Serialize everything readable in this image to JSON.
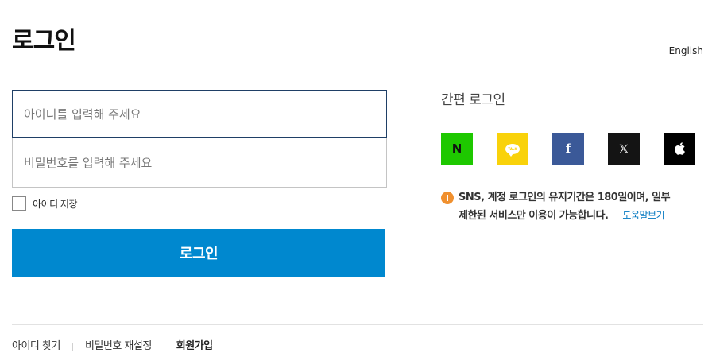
{
  "header": {
    "title": "로그인",
    "language_link": "English"
  },
  "form": {
    "id_placeholder": "아이디를 입력해 주세요",
    "password_placeholder": "비밀번호를 입력해 주세요",
    "remember_label": "아이디 저장",
    "remember_checked": false,
    "login_button": "로그인"
  },
  "simple_login": {
    "title": "간편 로그인",
    "providers": [
      {
        "name": "naver",
        "icon": "naver-icon",
        "color": "#1ec800",
        "glyph": "N"
      },
      {
        "name": "kakao",
        "icon": "kakao-icon",
        "color": "#f9d20a",
        "glyph": "TALK"
      },
      {
        "name": "facebook",
        "icon": "facebook-icon",
        "color": "#3b5998",
        "glyph": "f"
      },
      {
        "name": "x",
        "icon": "x-icon",
        "color": "#141414",
        "glyph": "𝕏"
      },
      {
        "name": "apple",
        "icon": "apple-icon",
        "color": "#000000",
        "glyph": ""
      }
    ],
    "notice_line1": "SNS, 계정 로그인의 유지기간은 180일이며, 일부",
    "notice_line2": "제한된 서비스만 이용이 가능합니다.",
    "help_link": "도움말보기"
  },
  "footer": {
    "find_id": "아이디 찾기",
    "reset_password": "비밀번호 재설정",
    "signup": "회원가입"
  },
  "colors": {
    "primary_button": "#0088cf",
    "focused_border": "#1f3f66",
    "notice_icon": "#f0902f",
    "help_link": "#0077c0"
  }
}
